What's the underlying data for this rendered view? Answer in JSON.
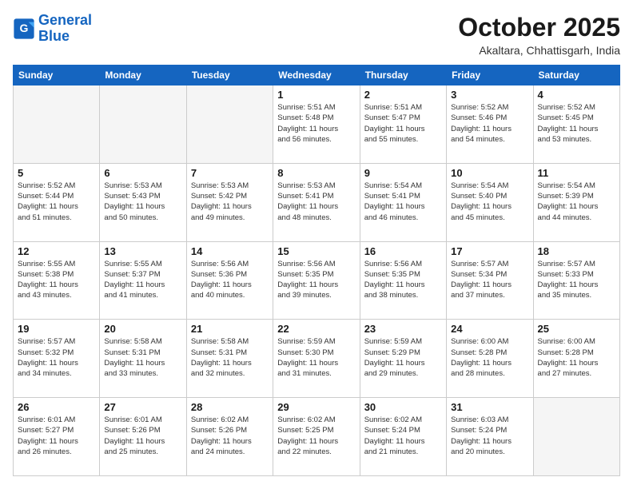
{
  "header": {
    "logo_line1": "General",
    "logo_line2": "Blue",
    "month": "October 2025",
    "location": "Akaltara, Chhattisgarh, India"
  },
  "weekdays": [
    "Sunday",
    "Monday",
    "Tuesday",
    "Wednesday",
    "Thursday",
    "Friday",
    "Saturday"
  ],
  "weeks": [
    [
      {
        "day": "",
        "info": ""
      },
      {
        "day": "",
        "info": ""
      },
      {
        "day": "",
        "info": ""
      },
      {
        "day": "1",
        "info": "Sunrise: 5:51 AM\nSunset: 5:48 PM\nDaylight: 11 hours\nand 56 minutes."
      },
      {
        "day": "2",
        "info": "Sunrise: 5:51 AM\nSunset: 5:47 PM\nDaylight: 11 hours\nand 55 minutes."
      },
      {
        "day": "3",
        "info": "Sunrise: 5:52 AM\nSunset: 5:46 PM\nDaylight: 11 hours\nand 54 minutes."
      },
      {
        "day": "4",
        "info": "Sunrise: 5:52 AM\nSunset: 5:45 PM\nDaylight: 11 hours\nand 53 minutes."
      }
    ],
    [
      {
        "day": "5",
        "info": "Sunrise: 5:52 AM\nSunset: 5:44 PM\nDaylight: 11 hours\nand 51 minutes."
      },
      {
        "day": "6",
        "info": "Sunrise: 5:53 AM\nSunset: 5:43 PM\nDaylight: 11 hours\nand 50 minutes."
      },
      {
        "day": "7",
        "info": "Sunrise: 5:53 AM\nSunset: 5:42 PM\nDaylight: 11 hours\nand 49 minutes."
      },
      {
        "day": "8",
        "info": "Sunrise: 5:53 AM\nSunset: 5:41 PM\nDaylight: 11 hours\nand 48 minutes."
      },
      {
        "day": "9",
        "info": "Sunrise: 5:54 AM\nSunset: 5:41 PM\nDaylight: 11 hours\nand 46 minutes."
      },
      {
        "day": "10",
        "info": "Sunrise: 5:54 AM\nSunset: 5:40 PM\nDaylight: 11 hours\nand 45 minutes."
      },
      {
        "day": "11",
        "info": "Sunrise: 5:54 AM\nSunset: 5:39 PM\nDaylight: 11 hours\nand 44 minutes."
      }
    ],
    [
      {
        "day": "12",
        "info": "Sunrise: 5:55 AM\nSunset: 5:38 PM\nDaylight: 11 hours\nand 43 minutes."
      },
      {
        "day": "13",
        "info": "Sunrise: 5:55 AM\nSunset: 5:37 PM\nDaylight: 11 hours\nand 41 minutes."
      },
      {
        "day": "14",
        "info": "Sunrise: 5:56 AM\nSunset: 5:36 PM\nDaylight: 11 hours\nand 40 minutes."
      },
      {
        "day": "15",
        "info": "Sunrise: 5:56 AM\nSunset: 5:35 PM\nDaylight: 11 hours\nand 39 minutes."
      },
      {
        "day": "16",
        "info": "Sunrise: 5:56 AM\nSunset: 5:35 PM\nDaylight: 11 hours\nand 38 minutes."
      },
      {
        "day": "17",
        "info": "Sunrise: 5:57 AM\nSunset: 5:34 PM\nDaylight: 11 hours\nand 37 minutes."
      },
      {
        "day": "18",
        "info": "Sunrise: 5:57 AM\nSunset: 5:33 PM\nDaylight: 11 hours\nand 35 minutes."
      }
    ],
    [
      {
        "day": "19",
        "info": "Sunrise: 5:57 AM\nSunset: 5:32 PM\nDaylight: 11 hours\nand 34 minutes."
      },
      {
        "day": "20",
        "info": "Sunrise: 5:58 AM\nSunset: 5:31 PM\nDaylight: 11 hours\nand 33 minutes."
      },
      {
        "day": "21",
        "info": "Sunrise: 5:58 AM\nSunset: 5:31 PM\nDaylight: 11 hours\nand 32 minutes."
      },
      {
        "day": "22",
        "info": "Sunrise: 5:59 AM\nSunset: 5:30 PM\nDaylight: 11 hours\nand 31 minutes."
      },
      {
        "day": "23",
        "info": "Sunrise: 5:59 AM\nSunset: 5:29 PM\nDaylight: 11 hours\nand 29 minutes."
      },
      {
        "day": "24",
        "info": "Sunrise: 6:00 AM\nSunset: 5:28 PM\nDaylight: 11 hours\nand 28 minutes."
      },
      {
        "day": "25",
        "info": "Sunrise: 6:00 AM\nSunset: 5:28 PM\nDaylight: 11 hours\nand 27 minutes."
      }
    ],
    [
      {
        "day": "26",
        "info": "Sunrise: 6:01 AM\nSunset: 5:27 PM\nDaylight: 11 hours\nand 26 minutes."
      },
      {
        "day": "27",
        "info": "Sunrise: 6:01 AM\nSunset: 5:26 PM\nDaylight: 11 hours\nand 25 minutes."
      },
      {
        "day": "28",
        "info": "Sunrise: 6:02 AM\nSunset: 5:26 PM\nDaylight: 11 hours\nand 24 minutes."
      },
      {
        "day": "29",
        "info": "Sunrise: 6:02 AM\nSunset: 5:25 PM\nDaylight: 11 hours\nand 22 minutes."
      },
      {
        "day": "30",
        "info": "Sunrise: 6:02 AM\nSunset: 5:24 PM\nDaylight: 11 hours\nand 21 minutes."
      },
      {
        "day": "31",
        "info": "Sunrise: 6:03 AM\nSunset: 5:24 PM\nDaylight: 11 hours\nand 20 minutes."
      },
      {
        "day": "",
        "info": ""
      }
    ]
  ]
}
